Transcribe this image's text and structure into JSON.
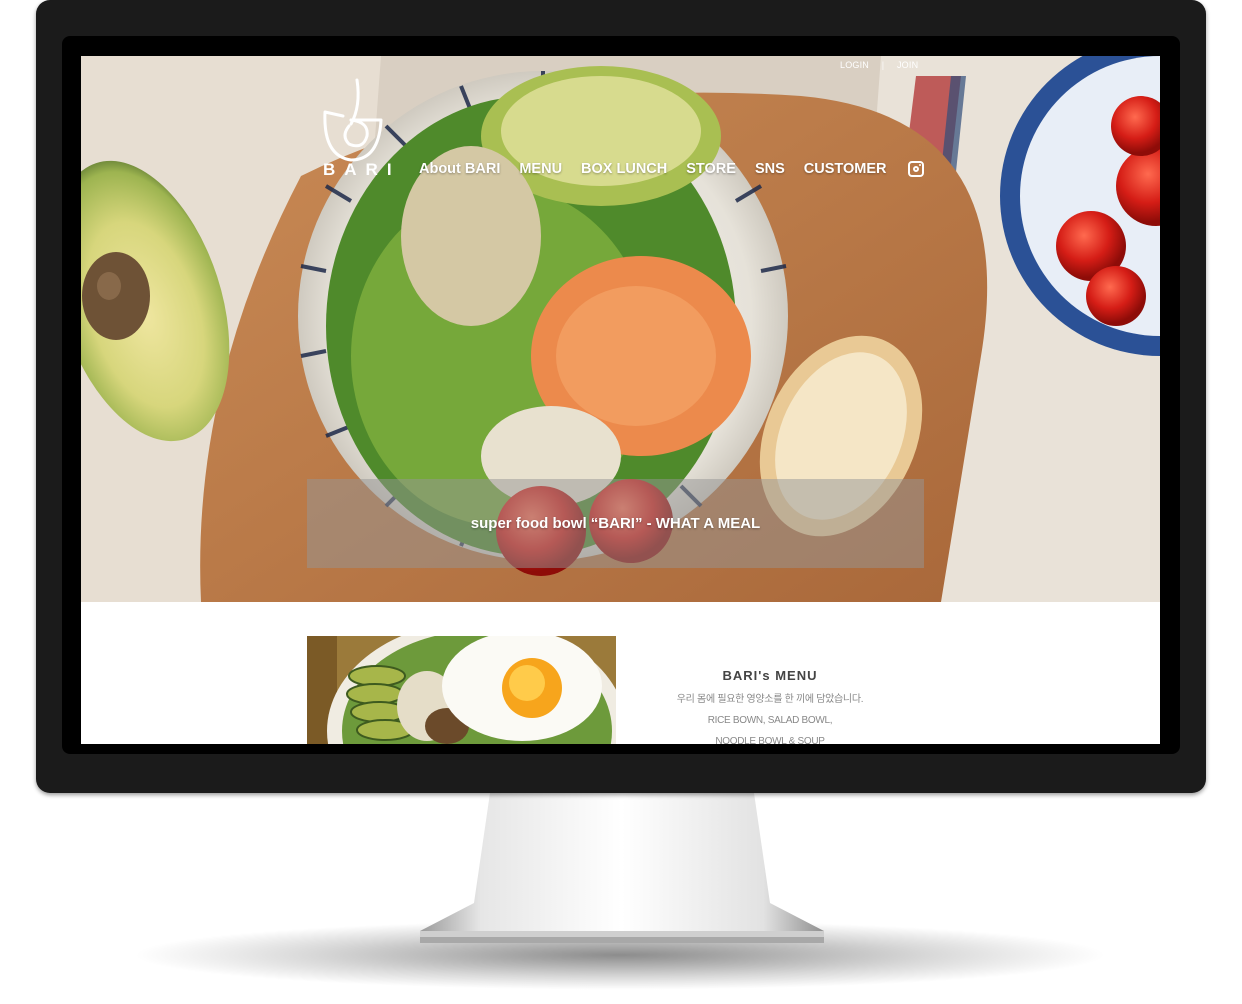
{
  "header": {
    "util_links": [
      {
        "label": "LOGIN"
      },
      {
        "label": "JOIN"
      }
    ],
    "logo_text": "BARI",
    "nav": [
      {
        "label": "About BARI"
      },
      {
        "label": "MENU"
      },
      {
        "label": "BOX LUNCH"
      },
      {
        "label": "STORE"
      },
      {
        "label": "SNS"
      },
      {
        "label": "CUSTOMER"
      }
    ],
    "instagram_icon": "instagram-icon"
  },
  "hero": {
    "tagline": "super food bowl “BARI” - WHAT A MEAL"
  },
  "menu_section": {
    "title": "BARI's MENU",
    "lines": [
      "우리 몸에 필요한 영양소를 한 끼에 담았습니다.",
      "RICE BOWN, SALAD BOWL,",
      "NOODLE BOWL & SOUP"
    ]
  },
  "colors": {
    "monitor_frame": "#1b1b1b",
    "banner_overlay": "rgba(150,150,150,0.5)",
    "menu_title": "#444444"
  }
}
